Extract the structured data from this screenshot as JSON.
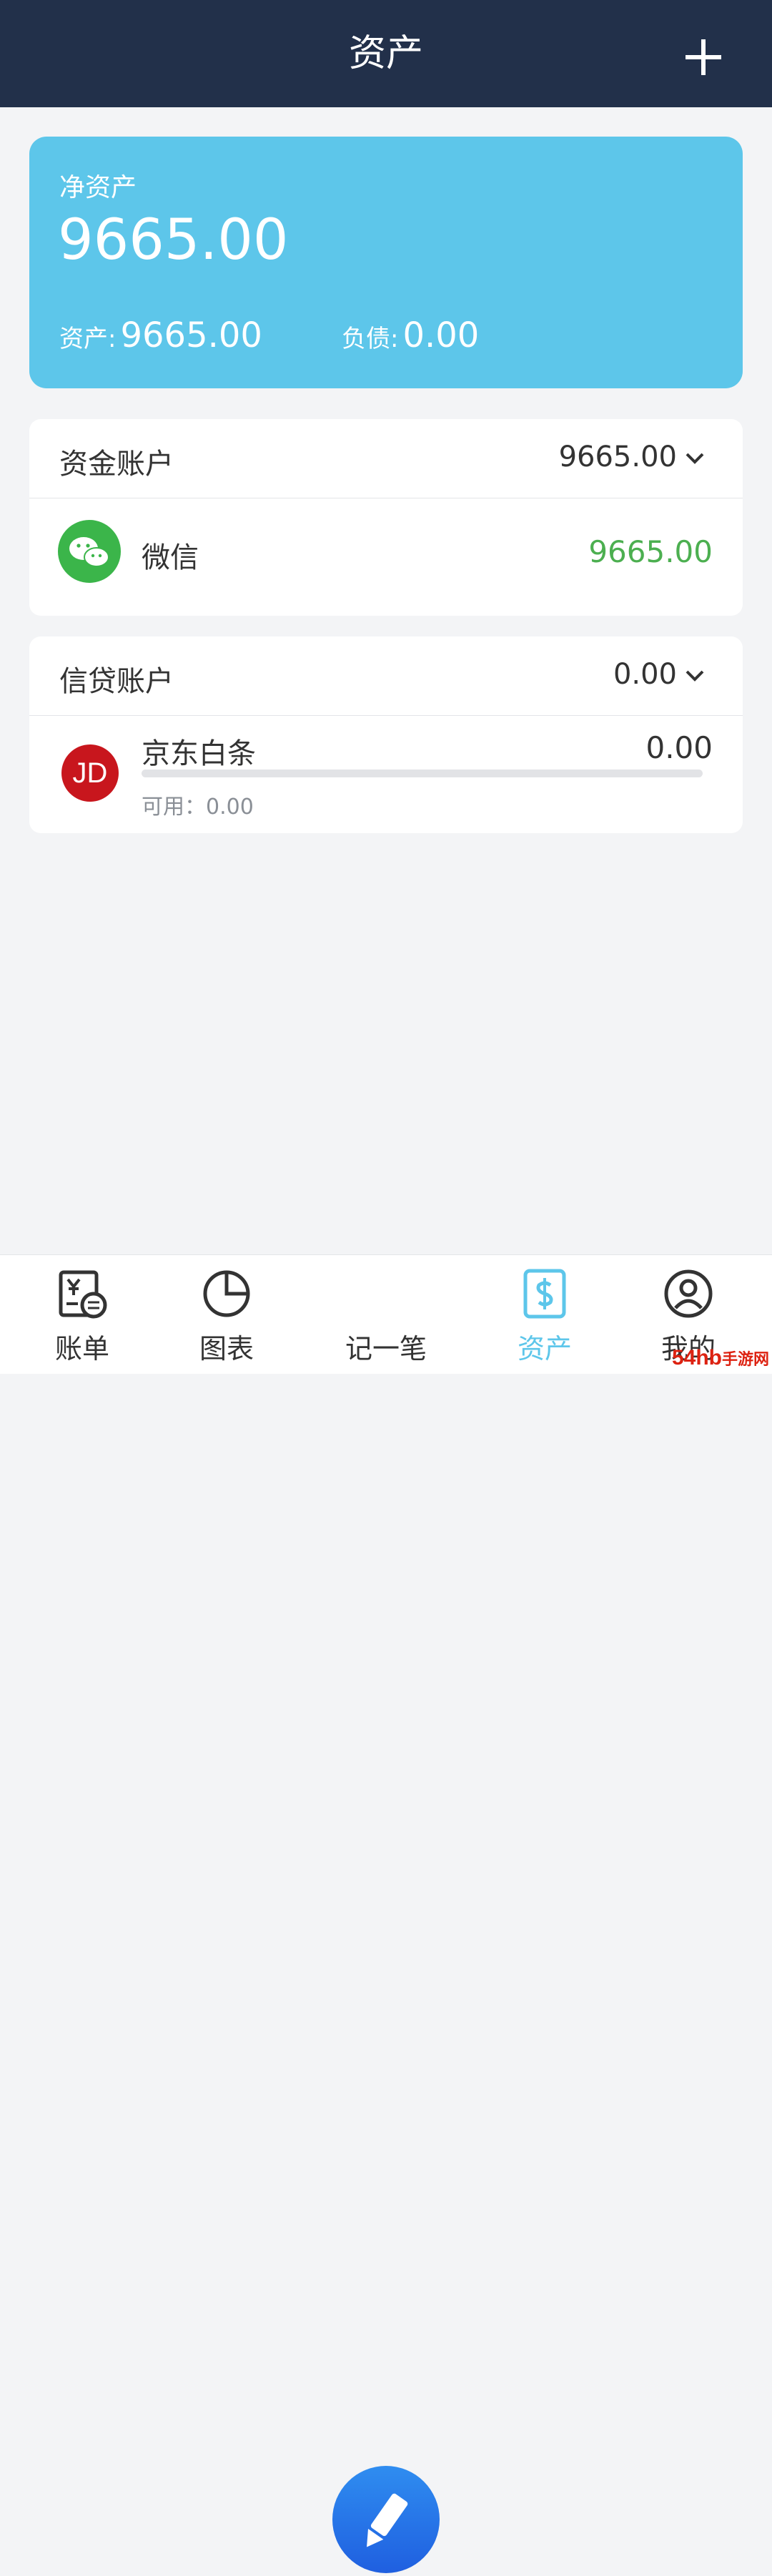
{
  "header": {
    "title": "资产"
  },
  "net_assets": {
    "label": "净资产",
    "value": "9665.00",
    "assets_label": "资产:",
    "assets_value": "9665.00",
    "liabilities_label": "负债:",
    "liabilities_value": "0.00"
  },
  "fund_accounts": {
    "title": "资金账户",
    "total": "9665.00",
    "items": [
      {
        "name": "微信",
        "amount": "9665.00"
      }
    ]
  },
  "credit_accounts": {
    "title": "信贷账户",
    "total": "0.00",
    "items": [
      {
        "name": "京东白条",
        "amount": "0.00",
        "available_label": "可用：",
        "available_value": "0.00",
        "icon_text": "JD",
        "usage_fraction": 0
      }
    ]
  },
  "tabs": [
    {
      "label": "账单",
      "icon": "bill-icon"
    },
    {
      "label": "图表",
      "icon": "chart-pie-icon"
    },
    {
      "label": "记一笔",
      "icon": "pencil-icon"
    },
    {
      "label": "资产",
      "icon": "asset-dollar-icon",
      "active": true
    },
    {
      "label": "我的",
      "icon": "profile-icon"
    }
  ],
  "colors": {
    "header_bg": "#22304a",
    "accent": "#5dc6ea",
    "positive": "#4caf50",
    "jd_red": "#c8161d"
  },
  "watermark": "54hb手游网"
}
